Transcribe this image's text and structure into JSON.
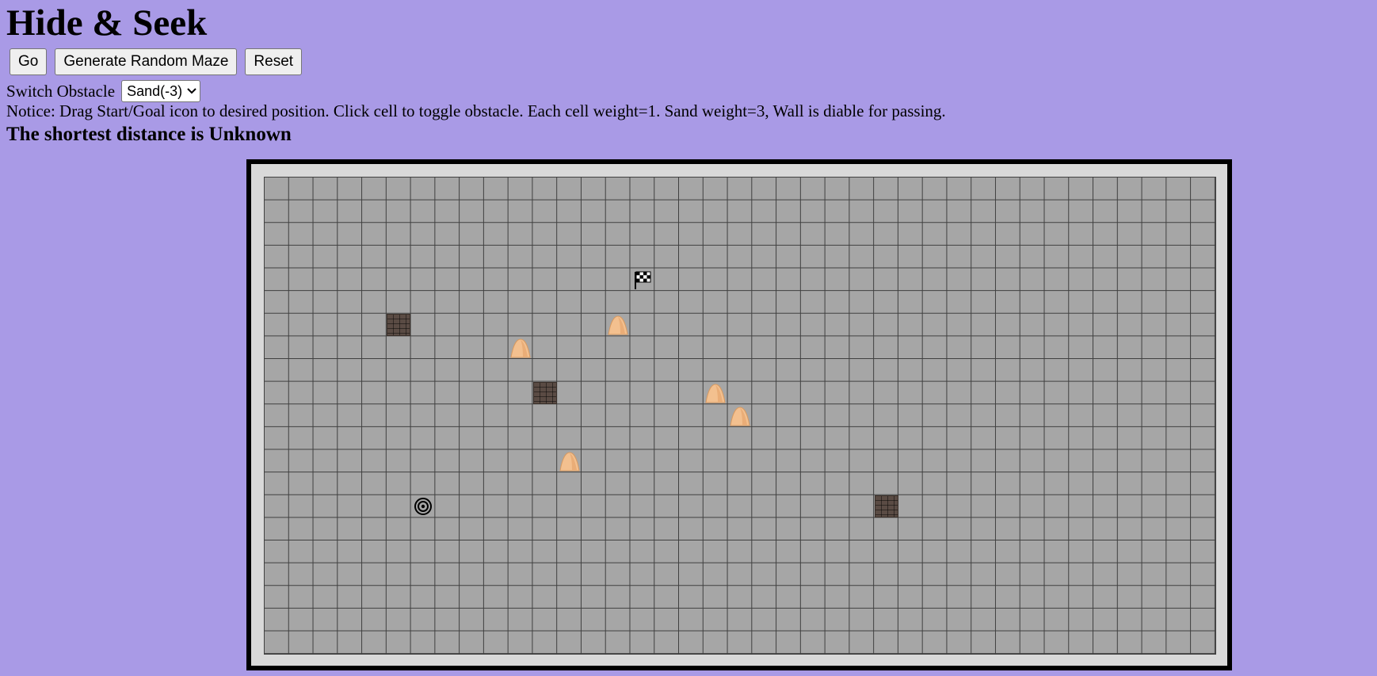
{
  "title": "Hide & Seek",
  "toolbar": {
    "go_label": "Go",
    "random_label": "Generate Random Maze",
    "reset_label": "Reset"
  },
  "obstacle": {
    "label": "Switch Obstacle",
    "selected": "Sand(-3)"
  },
  "notice": "Notice: Drag Start/Goal icon to desired position. Click cell to toggle obstacle. Each cell weight=1. Sand weight=3, Wall is diable for passing.",
  "distance_text": "The shortest distance is Unknown",
  "grid": {
    "columns": 39,
    "rows": 21,
    "cell_color": "#a6a6a6",
    "line_color": "#3f3f3f",
    "goal": {
      "col": 15,
      "row": 4,
      "icon": "checkered-flag-icon"
    },
    "start": {
      "col": 6,
      "row": 14,
      "icon": "target-icon"
    },
    "walls": [
      {
        "col": 5,
        "row": 6
      },
      {
        "col": 11,
        "row": 9
      },
      {
        "col": 25,
        "row": 14
      }
    ],
    "sands": [
      {
        "col": 14,
        "row": 6
      },
      {
        "col": 10,
        "row": 7
      },
      {
        "col": 18,
        "row": 9
      },
      {
        "col": 19,
        "row": 10
      },
      {
        "col": 12,
        "row": 12
      }
    ]
  },
  "colors": {
    "background": "#a99ae6",
    "frame": "#000000",
    "frame_inner": "#d9d9d9"
  }
}
